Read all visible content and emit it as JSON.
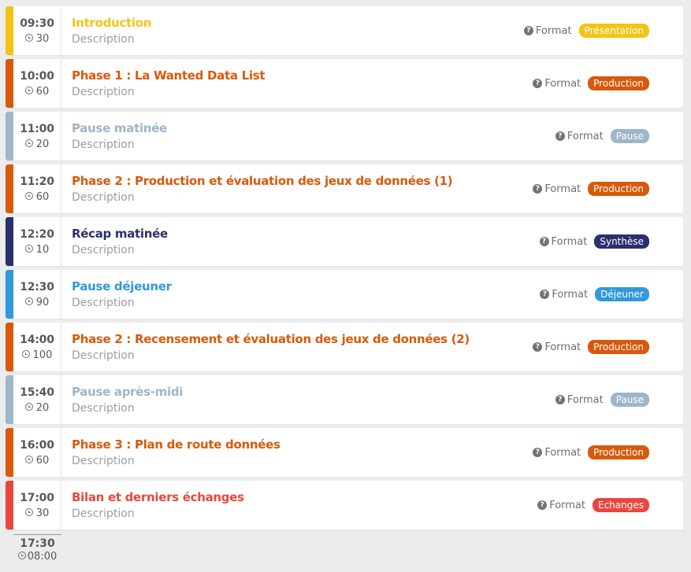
{
  "format_label": "Format",
  "items": [
    {
      "time": "09:30",
      "duration": "30",
      "title": "Introduction",
      "description": "Description",
      "badge": "Présentation",
      "color": "#f2c414"
    },
    {
      "time": "10:00",
      "duration": "60",
      "title": "Phase 1 : La Wanted Data List",
      "description": "Description",
      "badge": "Production",
      "color": "#d9590b"
    },
    {
      "time": "11:00",
      "duration": "20",
      "title": "Pause matinée",
      "description": "Description",
      "badge": "Pause",
      "color": "#9eb6c9"
    },
    {
      "time": "11:20",
      "duration": "60",
      "title": "Phase 2 : Production et évaluation des jeux de données (1)",
      "description": "Description",
      "badge": "Production",
      "color": "#d9590b"
    },
    {
      "time": "12:20",
      "duration": "10",
      "title": "Récap matinée",
      "description": "Description",
      "badge": "Synthèse",
      "color": "#2b2f6e"
    },
    {
      "time": "12:30",
      "duration": "90",
      "title": "Pause déjeuner",
      "description": "Description",
      "badge": "Déjeuner",
      "color": "#3298dc"
    },
    {
      "time": "14:00",
      "duration": "100",
      "title": "Phase 2 : Recensement et évaluation des jeux de données (2)",
      "description": "Description",
      "badge": "Production",
      "color": "#d9590b"
    },
    {
      "time": "15:40",
      "duration": "20",
      "title": "Pause après-midi",
      "description": "Description",
      "badge": "Pause",
      "color": "#9eb6c9"
    },
    {
      "time": "16:00",
      "duration": "60",
      "title": "Phase 3 : Plan de route données",
      "description": "Description",
      "badge": "Production",
      "color": "#d9590b"
    },
    {
      "time": "17:00",
      "duration": "30",
      "title": "Bilan et derniers échanges",
      "description": "Description",
      "badge": "Echanges",
      "color": "#e8473e"
    }
  ],
  "end": {
    "time": "17:30",
    "duration": "08:00"
  },
  "icons": {
    "duration": "clock-icon",
    "format": "question-circle-icon"
  }
}
